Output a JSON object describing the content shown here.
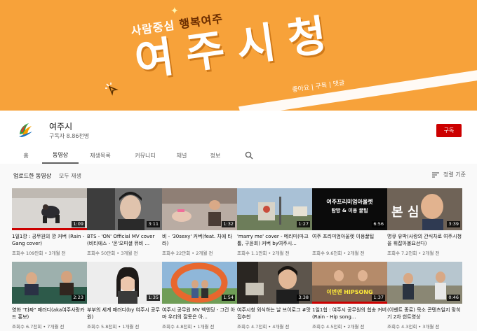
{
  "banner": {
    "subtitle_plain": "사람중심 ",
    "subtitle_highlight": "행복여주",
    "title": "여주시청",
    "tagline": "좋아요 | 구독 | 댓글"
  },
  "channel": {
    "name": "여주시",
    "subscribers": "구독자 8.86천명",
    "subscribe_label": "구독"
  },
  "tabs": [
    {
      "label": "홈"
    },
    {
      "label": "동영상"
    },
    {
      "label": "재생목록"
    },
    {
      "label": "커뮤니티"
    },
    {
      "label": "채널"
    },
    {
      "label": "정보"
    }
  ],
  "section": {
    "title": "업로드한 동영상",
    "play_all": "모두 재생",
    "sort_label": "정렬 기준"
  },
  "videos": [
    {
      "title": "1일1깡 : 공무원의 깡 커버 (Rain - Gang cover)",
      "meta": "조회수 109만회 • 3개월 전",
      "duration": "1:09",
      "progress": 1.0
    },
    {
      "title": "BTS - 'ON' Official MV cover (비티에스 - '온'오피셜 뮤비 ...",
      "meta": "조회수 50만회 • 3개월 전",
      "duration": "3:11",
      "progress": 0.0
    },
    {
      "title": "비 - '30sexy' 커버(feat. 차에 타라)",
      "meta": "조회수 22만회 • 2개월 전",
      "duration": "1:32",
      "progress": 0.0
    },
    {
      "title": "'marry me' cover - 메리미(마크툽, 구윤회) 커버 by여주시...",
      "meta": "조회수 1.1만회 • 2개월 전",
      "duration": "1:27",
      "progress": 0.0
    },
    {
      "title": "여주 프리미엄아울렛 이용꿀팁",
      "meta": "조회수 9.6천회 • 2개월 전",
      "duration": "6:56",
      "progress": 0.0
    },
    {
      "title": "명큐 유박(사랑의 간식차로 여주시청을 휘잡아볼요선다)",
      "meta": "조회수 7.2천회 • 2개월 전",
      "duration": "3:39",
      "progress": 0.0
    },
    {
      "title": "영화 \"타짜\" 패러디(aka여주사랑카드 홍보)",
      "meta": "조회수 6.7천회 • 7개월 전",
      "duration": "2:23",
      "progress": 0.0
    },
    {
      "title": "부부의 세계 패러디(by 여주시 공무원)",
      "meta": "조회수 5.8천회 • 1개월 전",
      "duration": "1:35",
      "progress": 0.0
    },
    {
      "title": "여주시 공무원 MV 벡엔딩 - 그건 아마 우리의 잘못은 아...",
      "meta": "조회수 4.8천회 • 1개월 전",
      "duration": "1:54",
      "progress": 0.0
    },
    {
      "title": "여주시청 외식하는 날 브이로그 #맛집추천",
      "meta": "조회수 4.7천회 • 4개월 전",
      "duration": "3:38",
      "progress": 0.0
    },
    {
      "title": "1일1힙 : 여주시 공무원의 힙송 커버 (Rain - Hip song...",
      "meta": "조회수 4.5천회 • 2개월 전",
      "duration": "1:37",
      "progress": 1.0
    },
    {
      "title": "(이벤트 종료) 묵소 콘텐츠일지 맞히기 2차 힌트영상",
      "meta": "조회수 4.3천회 • 3개월 전",
      "duration": "0:46",
      "progress": 0.0
    }
  ],
  "thumb_captions": {
    "v5_line1": "여주프리미엄아울렛",
    "v5_line2": "탐방 & 이용 꿀팁",
    "v6_text": "본 심",
    "v11_text": "이번엔 HIPSONG"
  },
  "colors": {
    "banner": "#f7a23a",
    "subscribe": "#cc0000",
    "progress": "#cc0000"
  }
}
